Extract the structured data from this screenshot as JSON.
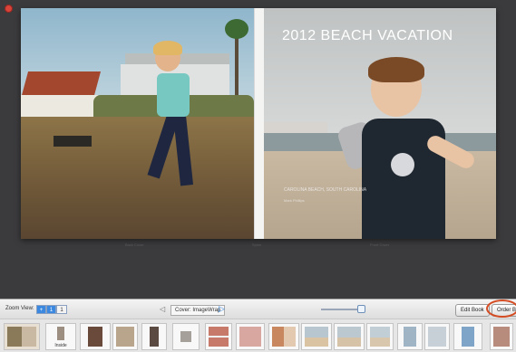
{
  "book": {
    "cover_title": "2012 BEACH VACATION",
    "cover_subtitle": "CAROLINA BEACH, SOUTH CAROLINA",
    "cover_subtitle2": "Mark Phillips",
    "page_labels": [
      "Back Cover",
      "Spine",
      "Front Cover"
    ]
  },
  "toolbar": {
    "zoom_label": "Zoom View:",
    "zoom_options": [
      "+",
      "1",
      "1"
    ],
    "center_label": "Cover: ImageWrap",
    "edit_label": "Edit Book",
    "order_label": "Order Book"
  },
  "thumbnails": {
    "caption": "Inside"
  },
  "colors": {
    "accent": "#3b88e0",
    "highlight_ring": "#d44c23",
    "close": "#d8433a"
  }
}
